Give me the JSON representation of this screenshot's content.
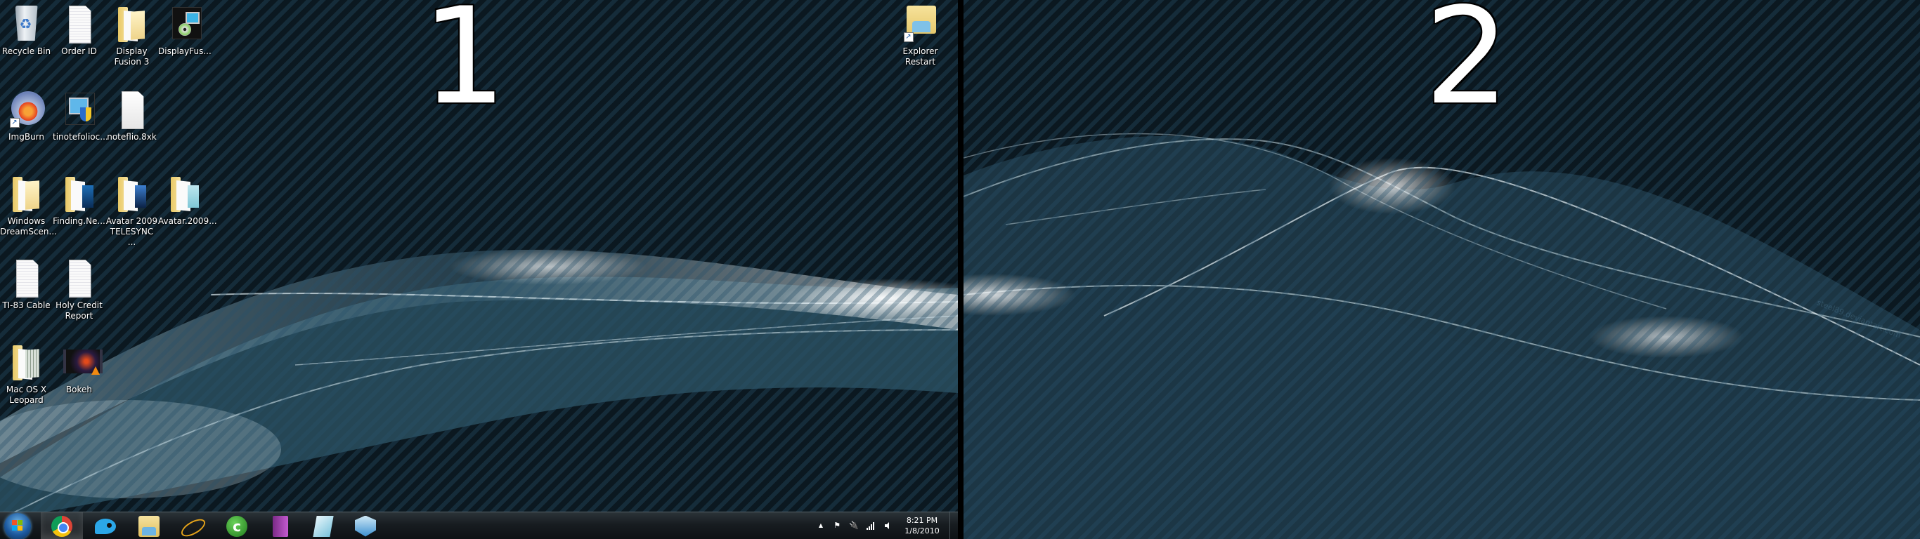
{
  "desktop": {
    "monitor_labels": [
      "1",
      "2"
    ],
    "wallpaper_watermark": "steel89.deviantart.com",
    "colors": {
      "background": "#0b1820",
      "stripe": "#13283a",
      "divider": "#000000",
      "wave_highlight": "#e8f2f6"
    }
  },
  "icons": [
    {
      "label": "Recycle Bin",
      "icon": "recycle-bin-icon"
    },
    {
      "label": "Order ID",
      "icon": "text-document-icon"
    },
    {
      "label": "Display Fusion 3",
      "icon": "folder-icon"
    },
    {
      "label": "DisplayFus...",
      "icon": "installer-icon"
    },
    {
      "label": "ImgBurn",
      "icon": "imgburn-icon"
    },
    {
      "label": "tinotefolioc...",
      "icon": "setup-shield-icon"
    },
    {
      "label": "noteflio.8xk",
      "icon": "blank-document-icon"
    },
    {
      "label": "Windows DreamScen...",
      "icon": "folder-icon"
    },
    {
      "label": "Finding.Ne...",
      "icon": "folder-icon"
    },
    {
      "label": "Avatar 2009 TELESYNC ...",
      "icon": "folder-icon"
    },
    {
      "label": "Avatar.2009...",
      "icon": "folder-icon"
    },
    {
      "label": "TI-83 Cable",
      "icon": "text-document-icon"
    },
    {
      "label": "Holy Credit Report",
      "icon": "text-document-icon"
    },
    {
      "label": "Mac OS X Leopard",
      "icon": "folder-icon"
    },
    {
      "label": "Bokeh",
      "icon": "video-file-icon"
    },
    {
      "label": "Explorer Restart",
      "icon": "explorer-shortcut-icon"
    }
  ],
  "taskbar": {
    "start_label": "Start",
    "pinned": [
      {
        "name": "Google Chrome",
        "active": true
      },
      {
        "name": "Pidgin",
        "active": false
      },
      {
        "name": "Windows Explorer",
        "active": false
      },
      {
        "name": "Internet Explorer",
        "active": false
      },
      {
        "name": "uTorrent",
        "active": false
      },
      {
        "name": "WinRAR",
        "active": false
      },
      {
        "name": "Notepad",
        "active": false
      },
      {
        "name": "VirtualBox",
        "active": false
      }
    ],
    "tray": {
      "show_hidden": "▲",
      "action_center": "flag",
      "power": "battery-plug",
      "network": "signal-bars",
      "volume": "speaker",
      "time": "8:21 PM",
      "date": "1/8/2010"
    }
  }
}
